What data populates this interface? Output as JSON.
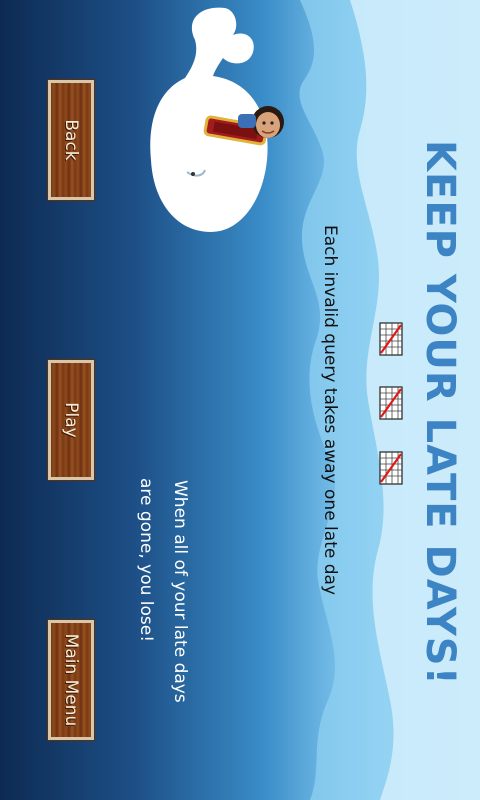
{
  "screen": {
    "title": "KEEP YOUR LATE DAYS!",
    "instruction": "Each invalid query takes away one late day",
    "warning_line_1": "When all of your late days",
    "warning_line_2": "are gone, you lose!"
  },
  "late_days": {
    "remaining": 3,
    "icon": "calendar-icon"
  },
  "buttons": {
    "back": "Back",
    "play": "Play",
    "main_menu": "Main Menu"
  },
  "colors": {
    "title": "#3d84c4",
    "ocean_dark": "#0d2a52",
    "ocean_light": "#bfe6fa",
    "button_wood": "#7a3a14"
  }
}
